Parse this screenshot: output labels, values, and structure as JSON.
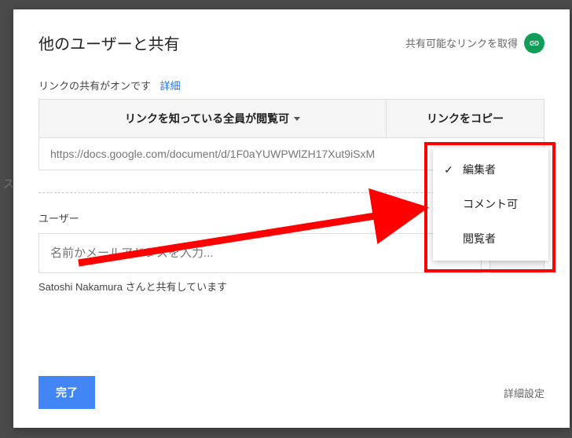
{
  "header": {
    "title": "他のユーザーと共有",
    "shareable_label": "共有可能なリンクを取得"
  },
  "link_section": {
    "status_text": "リンクの共有がオンです",
    "details_label": "詳細",
    "permission_summary": "リンクを知っている全員が閲覧可",
    "copy_link_label": "リンクをコピー",
    "url": "https://docs.google.com/document/d/1F0aYUWPWlZH17Xut9iSxM"
  },
  "users_section": {
    "label": "ユーザー",
    "input_placeholder": "名前かメールアドレスを入力...",
    "shared_with_text": "Satoshi Nakamura さんと共有しています"
  },
  "footer": {
    "done_label": "完了",
    "advanced_label": "詳細設定"
  },
  "dropdown": {
    "items": [
      {
        "label": "編集者",
        "checked": true
      },
      {
        "label": "コメント可",
        "checked": false
      },
      {
        "label": "閲覧者",
        "checked": false
      }
    ]
  },
  "gutter_char": "ス"
}
